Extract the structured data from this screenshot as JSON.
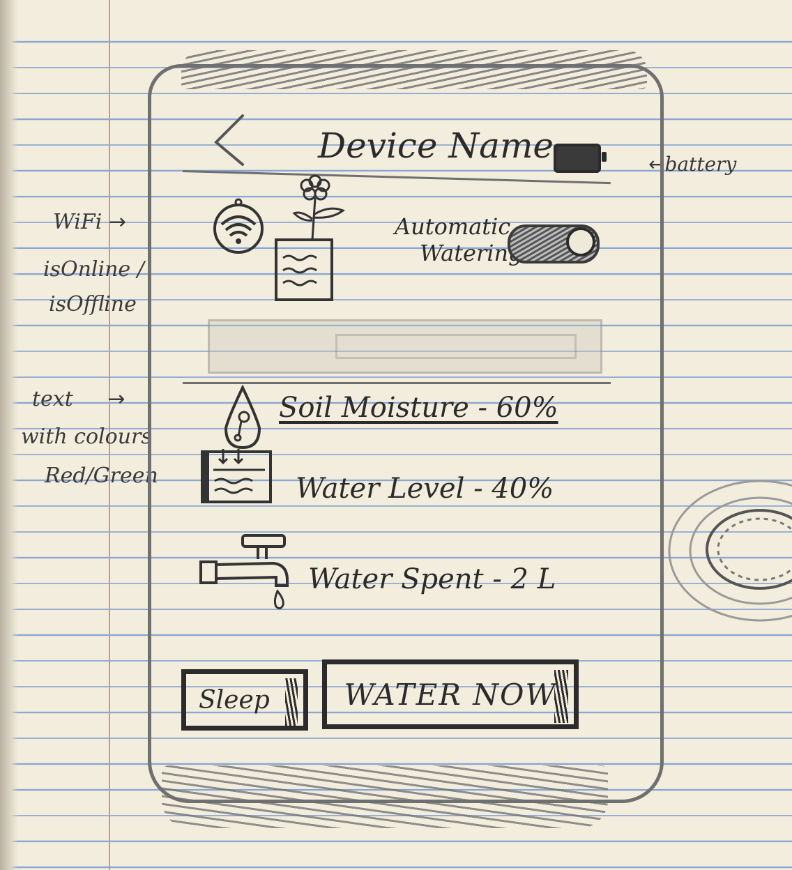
{
  "annotations": {
    "battery": "battery",
    "wifi_line1": "WiFi",
    "wifi_line2": "isOnline /",
    "wifi_line3": "isOffline",
    "text_line1": "text",
    "text_line2": "with colours",
    "text_line3": "Red/Green",
    "arrow": "→"
  },
  "header": {
    "title": "Device Name"
  },
  "automatic_watering": {
    "label_line1": "Automatic",
    "label_line2": "Watering",
    "enabled": true
  },
  "stats": {
    "soil_moisture": "Soil Moisture - 60%",
    "water_level": "Water Level - 40%",
    "water_spent": "Water Spent - 2 L"
  },
  "actions": {
    "sleep_label": "Sleep",
    "water_now_label": "WATER NOW"
  }
}
